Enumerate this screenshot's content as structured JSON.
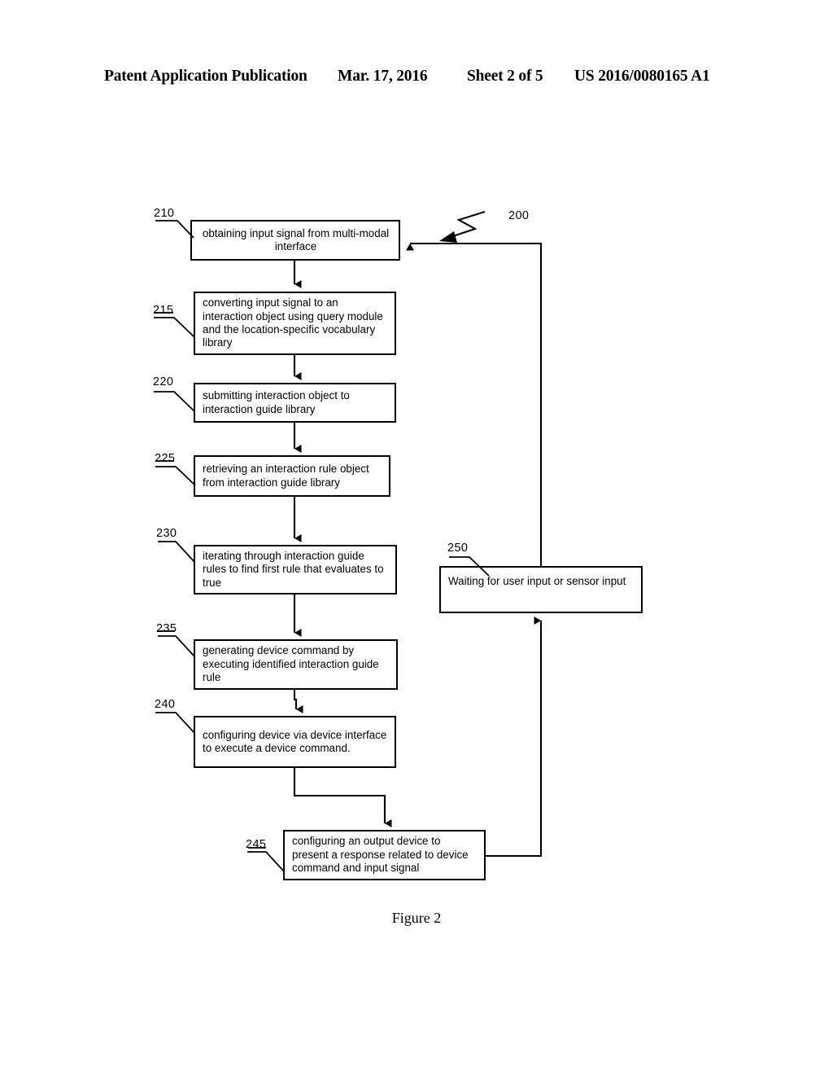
{
  "header": {
    "publication": "Patent Application Publication",
    "date": "Mar. 17, 2016",
    "sheet": "Sheet 2 of 5",
    "patent_number": "US 2016/0080165 A1"
  },
  "figure": {
    "caption": "Figure 2",
    "diagram_label": "200",
    "type": "flowchart",
    "line_color": "#000000",
    "background_color": "#ffffff"
  },
  "nodes": [
    {
      "ref": "210",
      "text": "obtaining input signal from multi-modal interface",
      "align": "center"
    },
    {
      "ref": "215",
      "text": "converting input signal to an interaction object using query module and the location-specific vocabulary library",
      "align": "left"
    },
    {
      "ref": "220",
      "text": "submitting interaction object to interaction guide library",
      "align": "left"
    },
    {
      "ref": "225",
      "text": "retrieving an interaction rule object from interaction guide library",
      "align": "left"
    },
    {
      "ref": "230",
      "text": "iterating through interaction guide rules to find first rule that evaluates to true",
      "align": "left"
    },
    {
      "ref": "235",
      "text": "generating device command by executing identified interaction guide rule",
      "align": "left"
    },
    {
      "ref": "240",
      "text": "configuring device via device interface to execute a device command.",
      "align": "left"
    },
    {
      "ref": "245",
      "text": "configuring an output device to present a response related to device command and input signal",
      "align": "left"
    },
    {
      "ref": "250",
      "text": "Waiting for user input or sensor input",
      "align": "left"
    }
  ]
}
